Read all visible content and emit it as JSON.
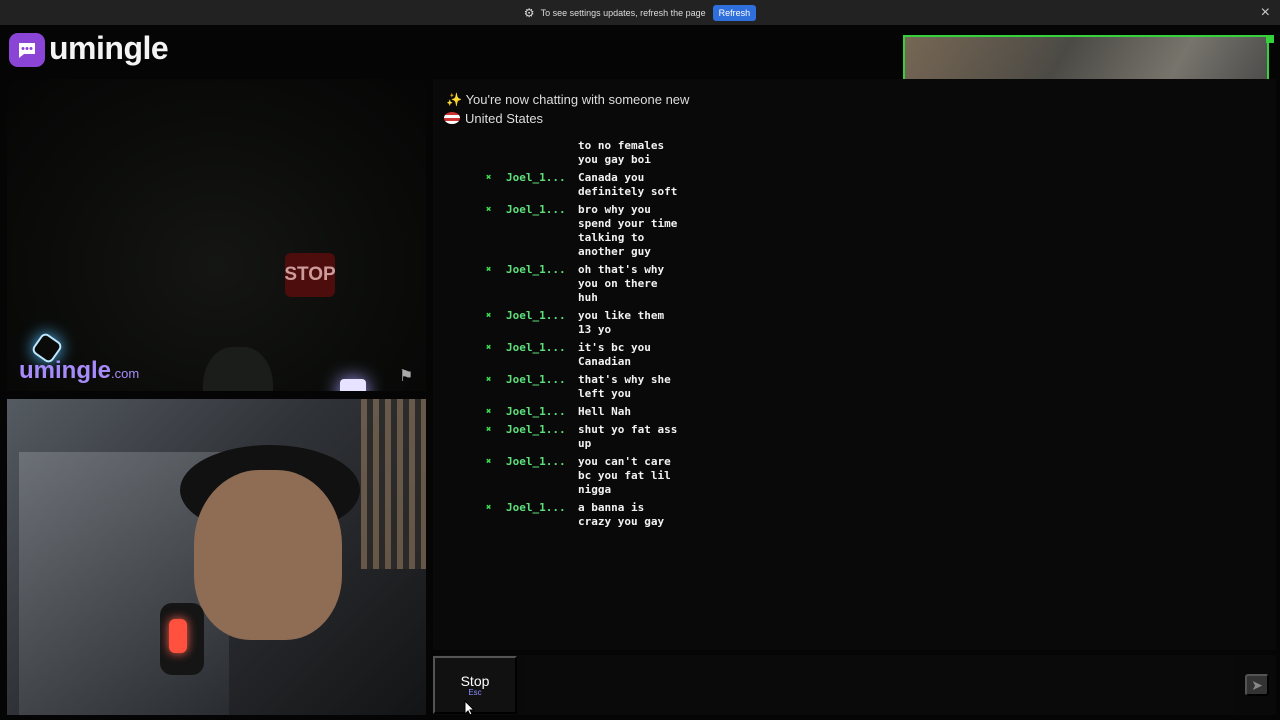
{
  "banner": {
    "text": "To see settings updates, refresh the page",
    "button": "Refresh"
  },
  "app": {
    "title": "umingle",
    "watermark": "umingle",
    "watermark_suffix": ".com"
  },
  "chat": {
    "status": "✨ You're now chatting with someone new",
    "country": "United States",
    "first_line": "to no females\nyou gay boi",
    "messages": [
      {
        "user": "Joel_1...",
        "text": "Canada you\ndefinitely soft"
      },
      {
        "user": "Joel_1...",
        "text": "bro why you\nspend your time\ntalking to\nanother guy"
      },
      {
        "user": "Joel_1...",
        "text": "oh that's why\nyou on there\nhuh"
      },
      {
        "user": "Joel_1...",
        "text": "you like them\n13 yo"
      },
      {
        "user": "Joel_1...",
        "text": "it's bc you\nCanadian"
      },
      {
        "user": "Joel_1...",
        "text": "that's why she\nleft you"
      },
      {
        "user": "Joel_1...",
        "text": "Hell Nah"
      },
      {
        "user": "Joel_1...",
        "text": "shut yo fat ass\nup"
      },
      {
        "user": "Joel_1...",
        "text": "you can't care\nbc you fat lil\nnigga"
      },
      {
        "user": "Joel_1...",
        "text": "a banna is\ncrazy you gay"
      }
    ]
  },
  "controls": {
    "stop": "Stop",
    "shortcut": "Esc",
    "input_placeholder": ""
  },
  "scene": {
    "stop_sign": "STOP"
  }
}
